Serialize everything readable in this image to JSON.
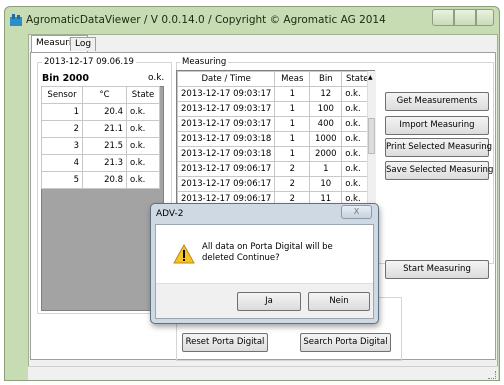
{
  "window": {
    "title": "AgromaticDataViewer / V 0.0.14.0 / Copyright © Agromatic AG 2014"
  },
  "tabs": [
    {
      "label": "Measuring"
    },
    {
      "label": "Log"
    }
  ],
  "sensor_panel": {
    "date": "2013-12-17 09.06.19",
    "bin_name": "Bin 2000",
    "bin_status": "o.k.",
    "columns": [
      "Sensor",
      "°C",
      "State"
    ],
    "rows": [
      [
        "1",
        "20.4",
        "o.k."
      ],
      [
        "2",
        "21.1",
        "o.k."
      ],
      [
        "3",
        "21.5",
        "o.k."
      ],
      [
        "4",
        "21.3",
        "o.k."
      ],
      [
        "5",
        "20.8",
        "o.k."
      ]
    ]
  },
  "measuring": {
    "group_label": "Measuring",
    "columns": [
      "Date / Time",
      "Meas",
      "Bin",
      "State"
    ],
    "rows": [
      [
        "2013-12-17 09:03:17",
        "1",
        "12",
        "o.k."
      ],
      [
        "2013-12-17 09:03:17",
        "1",
        "100",
        "o.k."
      ],
      [
        "2013-12-17 09:03:17",
        "1",
        "400",
        "o.k."
      ],
      [
        "2013-12-17 09:03:18",
        "1",
        "1000",
        "o.k."
      ],
      [
        "2013-12-17 09:03:18",
        "1",
        "2000",
        "o.k."
      ],
      [
        "2013-12-17 09:06:17",
        "2",
        "1",
        "o.k."
      ],
      [
        "2013-12-17 09:06:17",
        "2",
        "10",
        "o.k."
      ],
      [
        "2013-12-17 09:06:17",
        "2",
        "11",
        "o.k."
      ]
    ],
    "buttons": {
      "get": "Get Measurements",
      "import": "Import Measuring",
      "print": "Print Selected Measuring",
      "save": "Save Selected Measuring",
      "start": "Start Measuring"
    }
  },
  "porta": {
    "reset": "Reset Porta Digital",
    "search": "Search Porta Digital"
  },
  "dialog": {
    "title": "ADV-2",
    "message": "All data on Porta Digital will be deleted Continue?",
    "yes": "Ja",
    "no": "Nein",
    "icon": "warning-icon"
  },
  "colors": {
    "frame": "#c7dcb3",
    "dialog_frame": "#cfd9e4"
  }
}
